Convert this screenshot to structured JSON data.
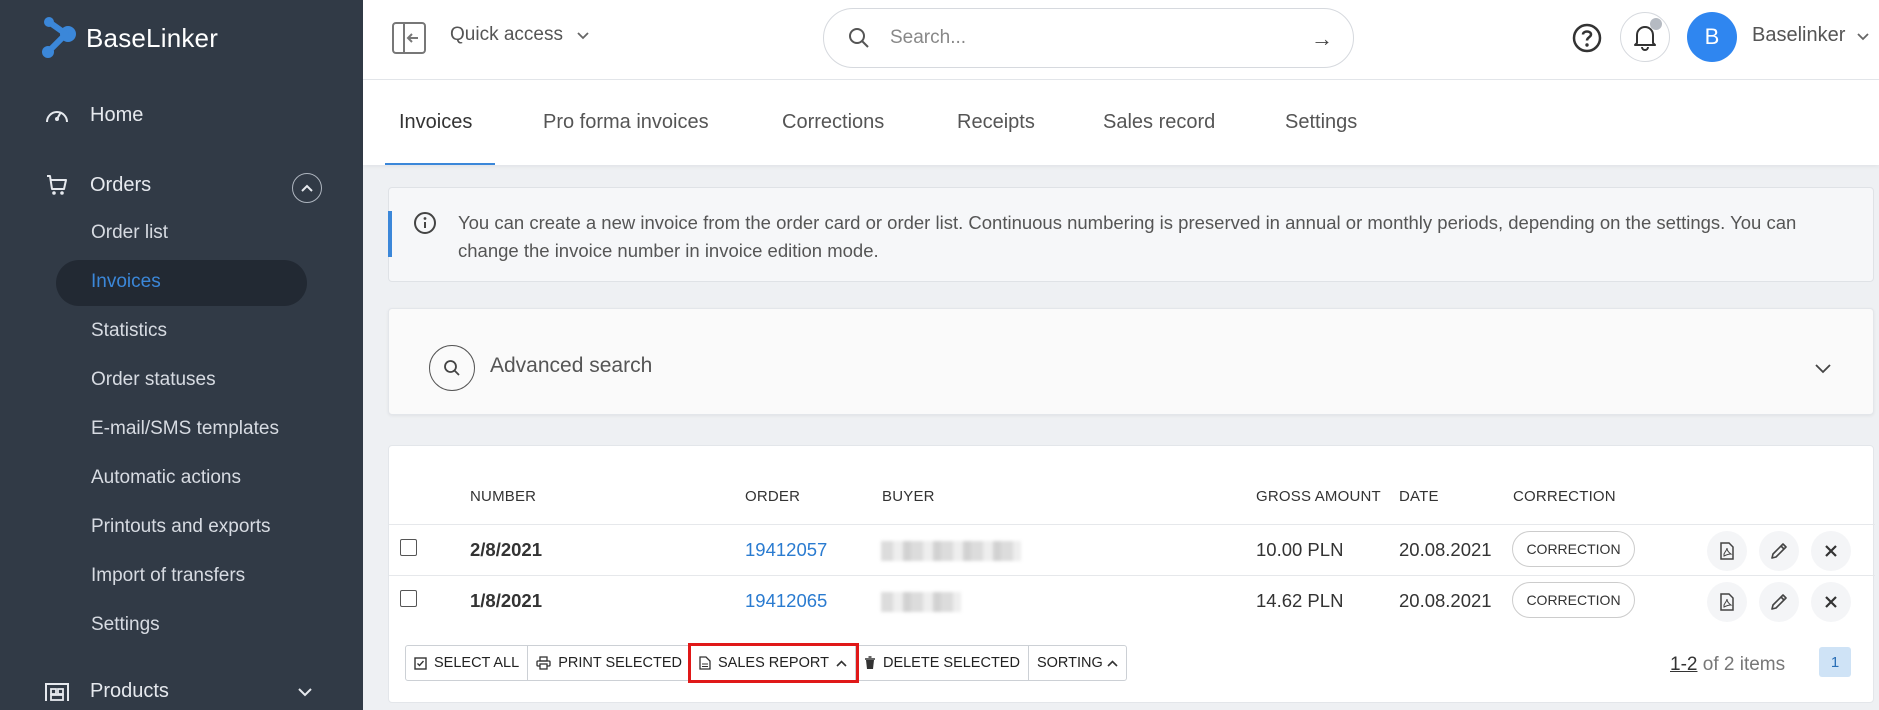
{
  "app": {
    "logo_text": "BaseLinker"
  },
  "sidebar": {
    "home": "Home",
    "orders": "Orders",
    "orders_sub": [
      "Order list",
      "Invoices",
      "Statistics",
      "Order statuses",
      "E-mail/SMS templates",
      "Automatic actions",
      "Printouts and exports",
      "Import of transfers",
      "Settings"
    ],
    "active_sub": "Invoices",
    "products": "Products"
  },
  "topbar": {
    "quick_access": "Quick access",
    "search_placeholder": "Search...",
    "avatar_letter": "B",
    "user_name": "Baselinker"
  },
  "tabs": [
    "Invoices",
    "Pro forma invoices",
    "Corrections",
    "Receipts",
    "Sales record",
    "Settings"
  ],
  "info": {
    "text": "You can create a new invoice from the order card or order list. Continuous numbering is preserved in annual or monthly periods, depending on the settings. You can change the invoice number in invoice edition mode."
  },
  "advanced_search": {
    "label": "Advanced search"
  },
  "table": {
    "headers": {
      "number": "NUMBER",
      "order": "ORDER",
      "buyer": "BUYER",
      "gross": "GROSS AMOUNT",
      "date": "DATE",
      "correction": "CORRECTION"
    },
    "rows": [
      {
        "number": "2/8/2021",
        "order": "19412057",
        "gross": "10.00 PLN",
        "date": "20.08.2021",
        "correction": "CORRECTION"
      },
      {
        "number": "1/8/2021",
        "order": "19412065",
        "gross": "14.62 PLN",
        "date": "20.08.2021",
        "correction": "CORRECTION"
      }
    ]
  },
  "toolbar": {
    "select_all": "SELECT ALL",
    "print_selected": "PRINT SELECTED",
    "sales_report": "SALES REPORT",
    "delete_selected": "DELETE SELECTED",
    "sorting": "SORTING"
  },
  "pager": {
    "range": "1-2",
    "suffix": " of 2 items",
    "page": "1"
  },
  "colors": {
    "sidebar_bg": "#313a46",
    "accent": "#3b87d9",
    "link": "#2a7bd0",
    "highlight": "#e01818",
    "avatar": "#2f86f0"
  }
}
